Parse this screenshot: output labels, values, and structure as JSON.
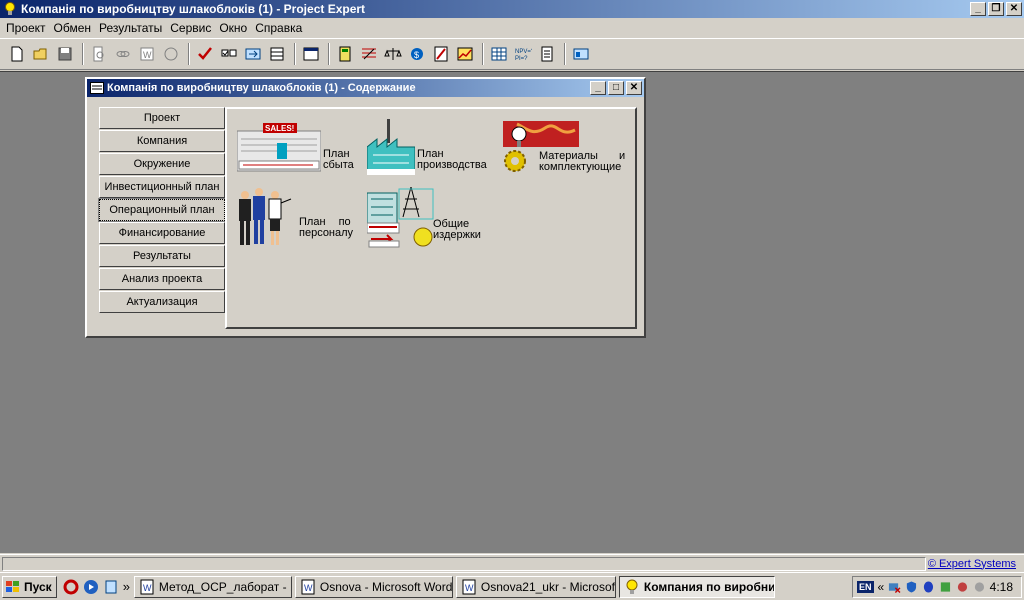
{
  "app": {
    "title": "Компанія по виробництву шлакоблоків (1) - Project Expert"
  },
  "menu": [
    "Проект",
    "Обмен",
    "Результаты",
    "Сервис",
    "Окно",
    "Справка"
  ],
  "child_window": {
    "title": "Компанія по виробництву шлакоблоків (1) - Содержание",
    "nav": [
      "Проект",
      "Компания",
      "Окружение",
      "Инвестиционный план",
      "Операционный план",
      "Финансирование",
      "Результаты",
      "Анализ проекта",
      "Актуализация"
    ],
    "active_nav": "Операционный план",
    "tiles": {
      "sales_plan": {
        "line1": "План",
        "line2": "сбыта",
        "badge": "SALES!"
      },
      "production_plan": {
        "line1": "План",
        "line2": "производства"
      },
      "materials": {
        "line1": "Материалы и",
        "line2": "комплектующие"
      },
      "staff_plan": {
        "line1": "План по",
        "line2": "персоналу"
      },
      "overheads": {
        "line1": "Общие",
        "line2": "издержки"
      }
    }
  },
  "status": {
    "link": "© Expert Systems"
  },
  "taskbar": {
    "start": "Пуск",
    "tasks": [
      {
        "label": "Метод_ОСР_лаборат - ...",
        "active": false
      },
      {
        "label": "Osnova - Microsoft Word",
        "active": false
      },
      {
        "label": "Osnova21_ukr - Microsof...",
        "active": false
      },
      {
        "label": "Компания по виробни...",
        "active": true
      }
    ],
    "language": "EN",
    "clock": "4:18"
  },
  "colors": {
    "titlebar_start": "#0a246a",
    "titlebar_end": "#a6caf0",
    "workspace": "#808080",
    "face": "#d4d0c8"
  }
}
